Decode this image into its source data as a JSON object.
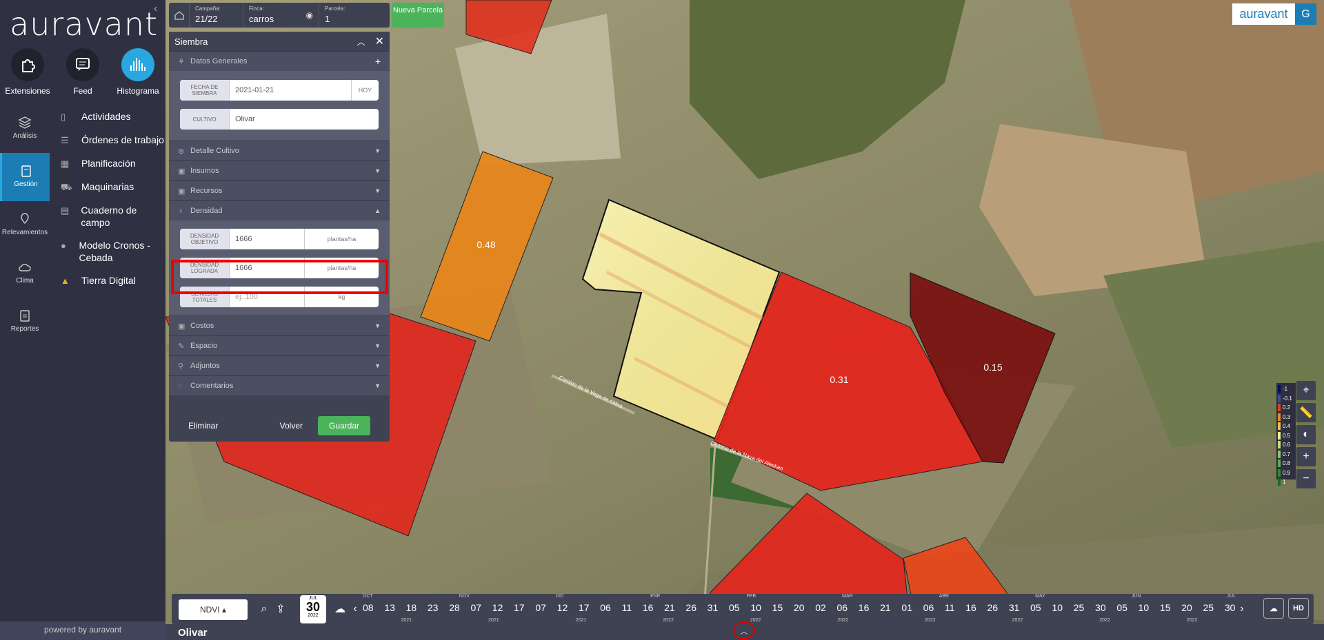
{
  "brand": {
    "logo": "auravant",
    "badge_logo": "auravant",
    "user_initial": "G",
    "powered_by": "powered by auravant"
  },
  "top_icons": [
    {
      "label": "Extensiones",
      "icon": "puzzle-icon"
    },
    {
      "label": "Feed",
      "icon": "chat-icon"
    },
    {
      "label": "Histograma",
      "icon": "histogram-icon"
    }
  ],
  "rail": [
    {
      "label": "Análisis",
      "icon": "layers-icon"
    },
    {
      "label": "Gestión",
      "icon": "clipboard-icon"
    },
    {
      "label": "Relevamientos",
      "icon": "pin-icon"
    },
    {
      "label": "Clima",
      "icon": "cloud-icon"
    },
    {
      "label": "Reportes",
      "icon": "report-icon"
    }
  ],
  "menu": [
    {
      "label": "Actividades"
    },
    {
      "label": "Órdenes de trabajo"
    },
    {
      "label": "Planificación"
    },
    {
      "label": "Maquinarias"
    },
    {
      "label": "Cuaderno de campo"
    },
    {
      "label": "Modelo Cronos - Cebada"
    },
    {
      "label": "Tierra Digital"
    }
  ],
  "topbar": {
    "campana_label": "Campaña:",
    "campana": "21/22",
    "finca_label": "Finca:",
    "finca": "carros",
    "parcela_label": "Parcela:",
    "parcela": "1",
    "nueva_parcela": "Nueva Parcela"
  },
  "panel": {
    "title": "Siembra",
    "datos_generales": "Datos Generales",
    "fecha_label": "FECHA DE SIEMBRA",
    "fecha": "2021-01-21",
    "hoy": "HOY",
    "cultivo_label": "CULTIVO",
    "cultivo": "Olivar",
    "sections_a": [
      "Detalle Cultivo",
      "Insumos",
      "Recursos"
    ],
    "densidad": "Densidad",
    "densidad_objetivo_label": "DENSIDAD OBJETIVO",
    "densidad_objetivo": "1666",
    "densidad_lograda_label": "DENSIDAD LOGRADA",
    "densidad_lograda": "1666",
    "semillas_label": "SEMILLAS TOTALES",
    "semillas_placeholder": "ej. 100",
    "unit_plantas": "plantas/ha",
    "unit_kg": "kg",
    "sections_b": [
      "Costos",
      "Espacio",
      "Adjuntos",
      "Comentarios"
    ],
    "eliminar": "Eliminar",
    "volver": "Volver",
    "guardar": "Guardar"
  },
  "map": {
    "labels": [
      "0.48",
      "0.31",
      "0.15"
    ],
    "road_labels": [
      "Camino de la Vega de Aldea",
      "Camino de la Nava del Alaskan"
    ]
  },
  "legend": [
    {
      "v": "-1",
      "c": "#0a0a6a"
    },
    {
      "v": "-0.1",
      "c": "#3050b0"
    },
    {
      "v": "0.2",
      "c": "#d9451e"
    },
    {
      "v": "0.3",
      "c": "#ea8b2b"
    },
    {
      "v": "0.4",
      "c": "#f3c23e"
    },
    {
      "v": "0.5",
      "c": "#f7ef8a"
    },
    {
      "v": "0.6",
      "c": "#c4e07a"
    },
    {
      "v": "0.7",
      "c": "#8cc95e"
    },
    {
      "v": "0.8",
      "c": "#5ab04a"
    },
    {
      "v": "0.9",
      "c": "#2e8c36"
    },
    {
      "v": "1",
      "c": "#126b26"
    }
  ],
  "timeline": {
    "index": "NDVI",
    "date_month": "JUL",
    "date_day": "30",
    "date_year": "2022",
    "months": [
      "OCT",
      "NOV",
      "DIC",
      "ENE",
      "FEB",
      "MAR",
      "ABR",
      "MAY",
      "JUN",
      "JUL"
    ],
    "days": [
      "08",
      "13",
      "18",
      "23",
      "28",
      "07",
      "12",
      "17",
      "07",
      "12",
      "17",
      "06",
      "11",
      "16",
      "21",
      "26",
      "31",
      "05",
      "10",
      "15",
      "20",
      "02",
      "06",
      "16",
      "21",
      "01",
      "06",
      "11",
      "16",
      "26",
      "31",
      "05",
      "10",
      "25",
      "30",
      "05",
      "10",
      "15",
      "20",
      "25",
      "30"
    ],
    "years": [
      "2021",
      "2021",
      "2021",
      "2022",
      "2022",
      "2022",
      "2022",
      "2022",
      "2022",
      "2022"
    ],
    "hd": "HD"
  },
  "bottom_title": "Olivar"
}
